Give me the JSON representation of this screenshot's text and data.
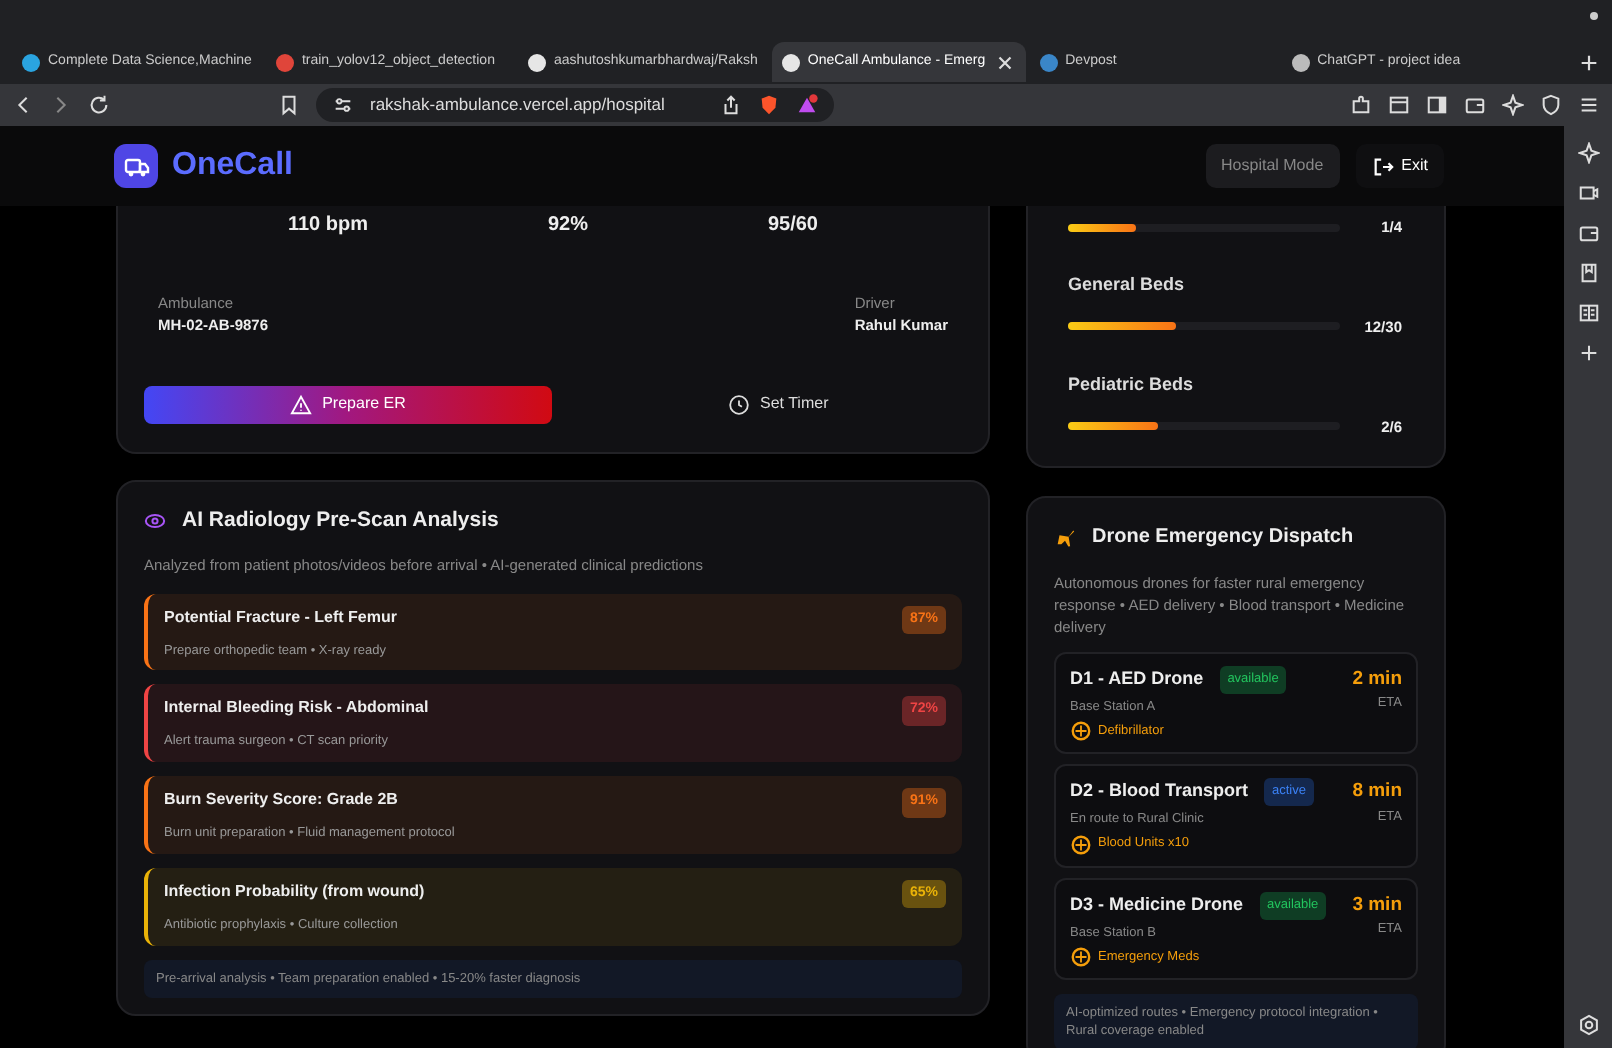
{
  "browser": {
    "tabs": [
      {
        "title": "Complete Data Science,Machine",
        "selected": false,
        "color": "#2aa4e0"
      },
      {
        "title": "train_yolov12_object_detection",
        "selected": false,
        "color": "#e0453a"
      },
      {
        "title": "aashutoshkumarbhardwaj/Raksh",
        "selected": false,
        "color": "#e6e6e6"
      },
      {
        "title": "OneCall Ambulance - Emerg",
        "selected": true,
        "color": "#e6e6e6"
      },
      {
        "title": "Devpost",
        "selected": false,
        "color": "#3a86c8"
      },
      {
        "title": "ChatGPT - project idea",
        "selected": false,
        "color": "#bbbbbb"
      }
    ],
    "url": "rakshak-ambulance.vercel.app/hospital"
  },
  "header": {
    "brand": "OneCall",
    "mode_button": "Hospital Mode",
    "exit_button": "Exit"
  },
  "patient_card": {
    "vitals": [
      "110 bpm",
      "92%",
      "95/60"
    ],
    "ambulance_label": "Ambulance",
    "ambulance": "MH-02-AB-9876",
    "driver_label": "Driver",
    "driver": "Rahul Kumar",
    "prepare_button": "Prepare ER",
    "timer_button": "Set Timer"
  },
  "beds": [
    {
      "count": "1/4",
      "level": 0.25
    },
    {
      "name": "General Beds",
      "count": "12/30",
      "level": 0.4
    },
    {
      "name": "Pediatric Beds",
      "count": "2/6",
      "level": 0.333
    }
  ],
  "radiology": {
    "title": "AI Radiology Pre-Scan Analysis",
    "subtitle": "Analyzed from patient photos/videos before arrival • AI-generated clinical predictions",
    "findings": [
      {
        "title": "Potential Fracture - Left Femur",
        "detail": "Prepare orthopedic team • X-ray ready",
        "confidence": "87%",
        "color": "#f97316"
      },
      {
        "title": "Internal Bleeding Risk - Abdominal",
        "detail": "Alert trauma surgeon • CT scan priority",
        "confidence": "72%",
        "color": "#ef4444"
      },
      {
        "title": "Burn Severity Score: Grade 2B",
        "detail": "Burn unit preparation • Fluid management protocol",
        "confidence": "91%",
        "color": "#f97316"
      },
      {
        "title": "Infection Probability (from wound)",
        "detail": "Antibiotic prophylaxis • Culture collection",
        "confidence": "65%",
        "color": "#eab308"
      }
    ],
    "footer": "Pre-arrival analysis • Team preparation enabled • 15-20% faster diagnosis"
  },
  "drones": {
    "title": "Drone Emergency Dispatch",
    "subtitle": "Autonomous drones for faster rural emergency response • AED delivery • Blood transport • Medicine delivery",
    "items": [
      {
        "name": "D1 - AED Drone",
        "status": "available",
        "location": "Base Station A",
        "cargo": "Defibrillator",
        "eta": "2 min",
        "eta_label": "ETA"
      },
      {
        "name": "D2 - Blood Transport",
        "status": "active",
        "location": "En route to Rural Clinic",
        "cargo": "Blood Units x10",
        "eta": "8 min",
        "eta_label": "ETA"
      },
      {
        "name": "D3 - Medicine Drone",
        "status": "available",
        "location": "Base Station B",
        "cargo": "Emergency Meds",
        "eta": "3 min",
        "eta_label": "ETA"
      }
    ],
    "footer": "AI-optimized routes • Emergency protocol integration • Rural coverage enabled"
  }
}
